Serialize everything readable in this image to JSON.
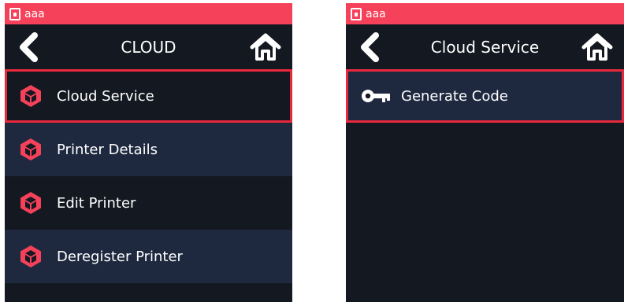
{
  "colors": {
    "accent": "#f6415a",
    "selection": "#e8283d",
    "background": "#141820",
    "row_alt": "#1e2940",
    "text": "#ffffff"
  },
  "left_screen": {
    "status": {
      "text": "aaa",
      "icon": "sd-card-icon"
    },
    "nav": {
      "title": "CLOUD",
      "back_icon": "chevron-left-icon",
      "home_icon": "home-icon"
    },
    "items": [
      {
        "label": "Cloud Service",
        "icon": "cloud-cube-icon",
        "selected": true
      },
      {
        "label": "Printer Details",
        "icon": "cloud-cube-icon",
        "selected": false
      },
      {
        "label": "Edit Printer",
        "icon": "cloud-cube-icon",
        "selected": false
      },
      {
        "label": "Deregister Printer",
        "icon": "cloud-cube-icon",
        "selected": false
      }
    ]
  },
  "right_screen": {
    "status": {
      "text": "aaa",
      "icon": "sd-card-icon"
    },
    "nav": {
      "title": "Cloud Service",
      "back_icon": "chevron-left-icon",
      "home_icon": "home-icon"
    },
    "items": [
      {
        "label": "Generate Code",
        "icon": "key-icon",
        "selected": true
      }
    ]
  }
}
